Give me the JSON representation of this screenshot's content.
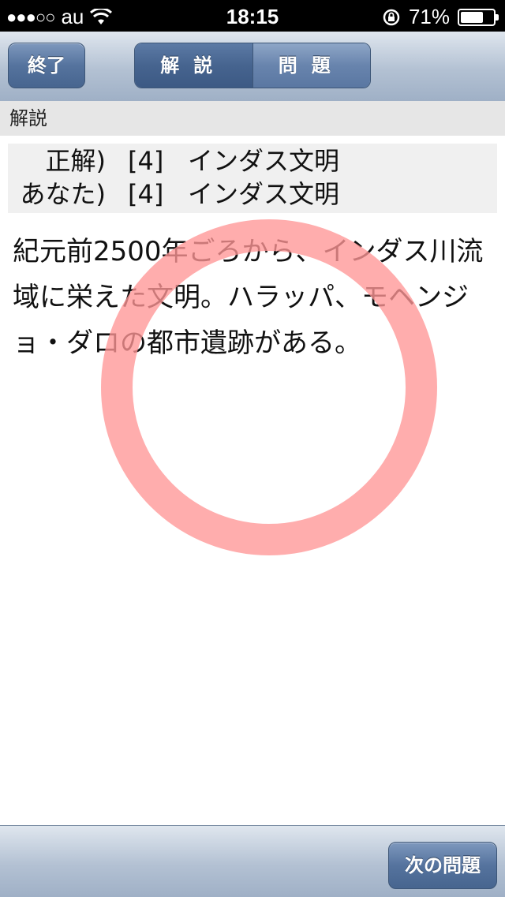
{
  "status_bar": {
    "carrier": "au",
    "time": "18:15",
    "battery_percent_text": "71%",
    "battery_level": 0.71
  },
  "nav": {
    "end_button": "終了",
    "segments": [
      {
        "label": "解説",
        "active": true
      },
      {
        "label": "問題",
        "active": false
      }
    ]
  },
  "section_title": "解説",
  "answers": [
    {
      "label": "正解)",
      "number": "[4]",
      "text": "インダス文明"
    },
    {
      "label": "あなた)",
      "number": "[4]",
      "text": "インダス文明"
    }
  ],
  "explanation": "紀元前2500年ごろから、インダス川流域に栄えた文明。ハラッパ、モヘンジョ・ダロの都市遺跡がある。",
  "result_mark": "correct-circle",
  "toolbar": {
    "next_button": "次の問題"
  }
}
